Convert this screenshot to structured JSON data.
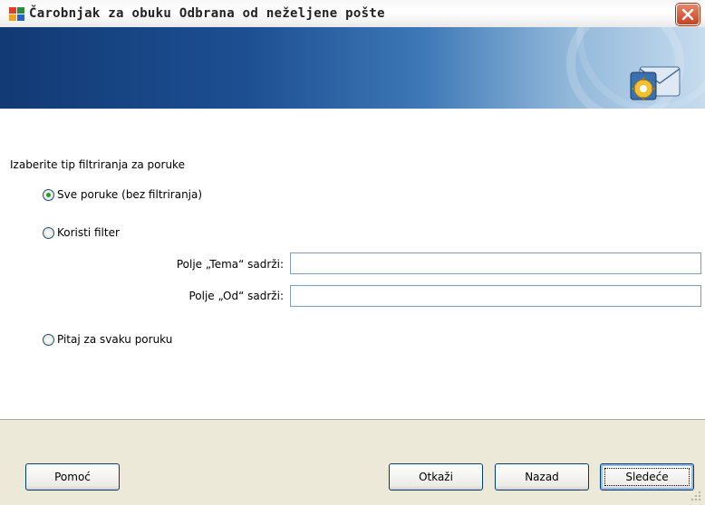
{
  "window": {
    "title": "Čarobnjak za obuku Odbrana od neželjene pošte"
  },
  "content": {
    "prompt": "Izaberite tip filtriranja za poruke",
    "options": [
      {
        "label": "Sve poruke (bez filtriranja)",
        "checked": true
      },
      {
        "label": "Koristi filter",
        "checked": false
      },
      {
        "label": "Pitaj za svaku poruku",
        "checked": false
      }
    ],
    "subject_field": {
      "label": "Polje „Tema“ sadrži:",
      "value": ""
    },
    "from_field": {
      "label": "Polje „Od“ sadrži:",
      "value": ""
    }
  },
  "buttons": {
    "help": "Pomoć",
    "cancel": "Otkaži",
    "back": "Nazad",
    "next": "Sledeće"
  },
  "colors": {
    "banner_dark": "#123a74",
    "banner_light": "#c6dcee",
    "radio_dot": "#21a121"
  }
}
